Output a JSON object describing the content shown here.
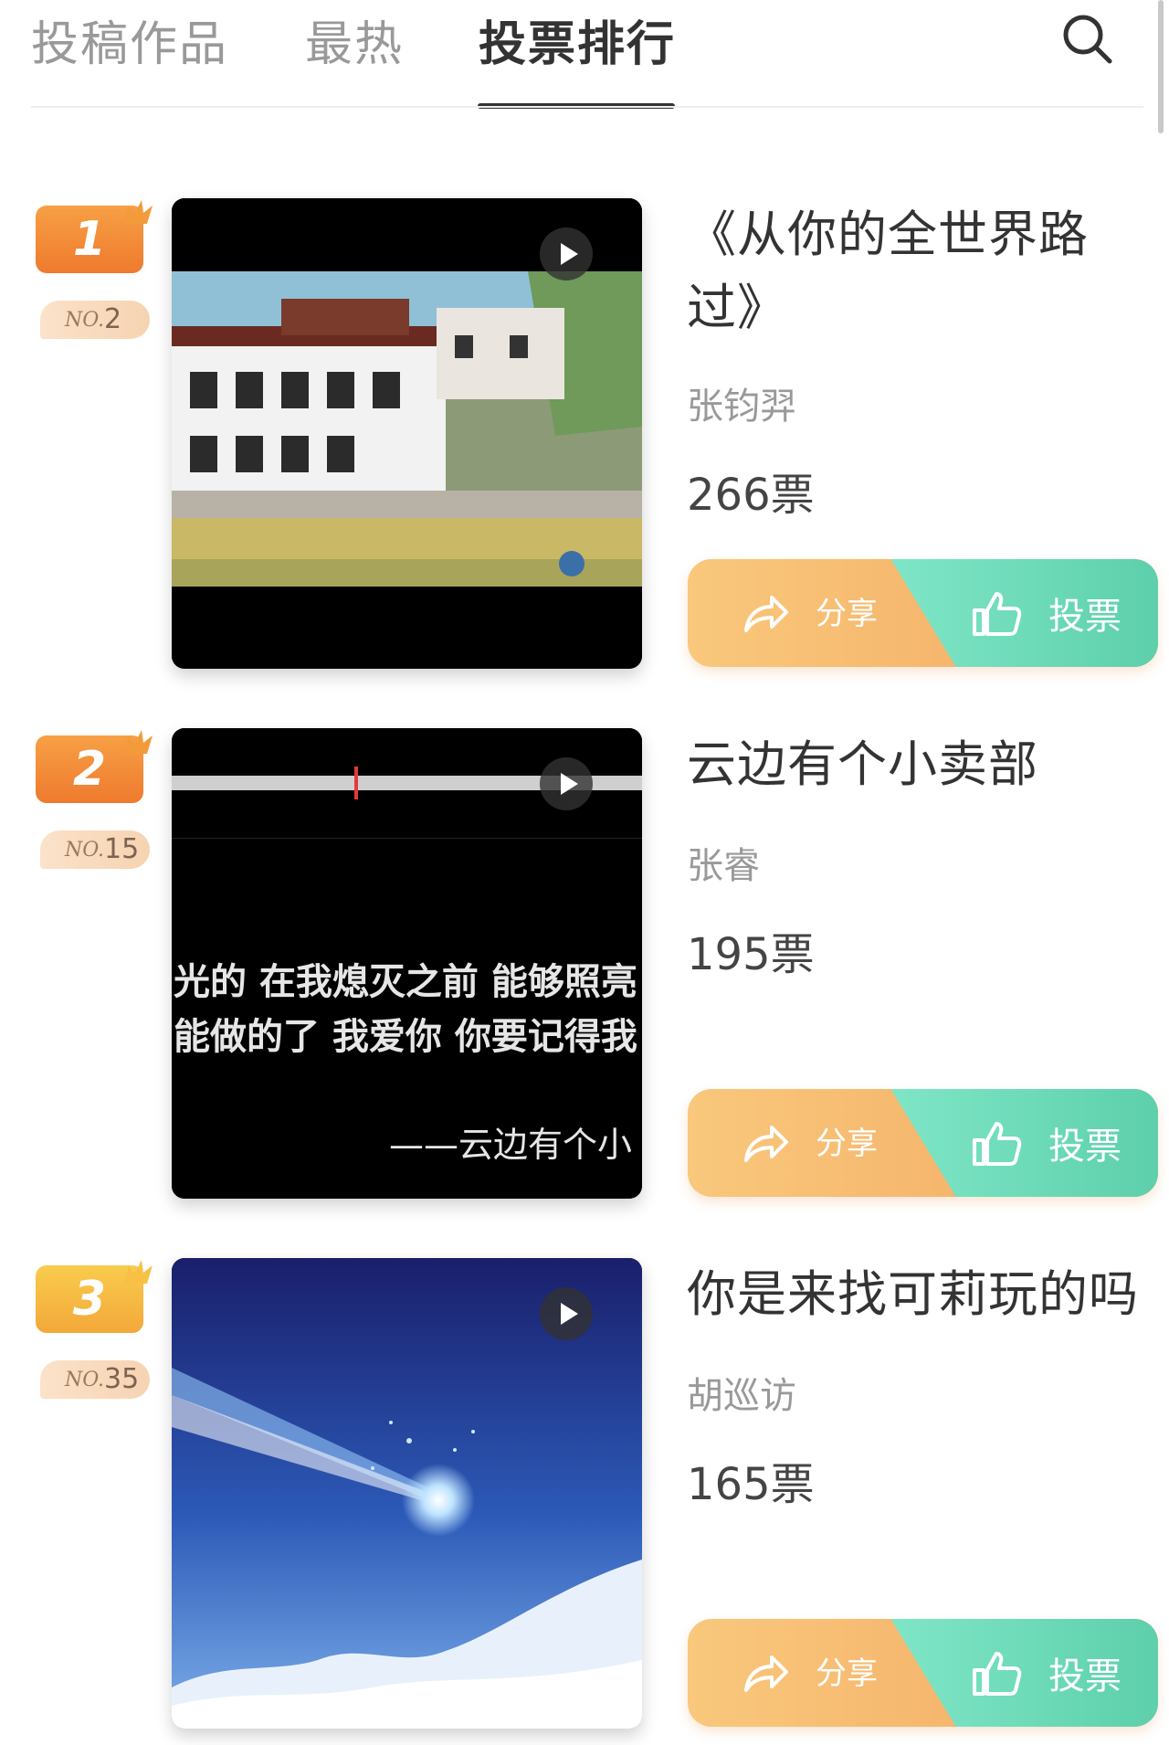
{
  "tabs": {
    "items": [
      {
        "label": "投稿作品",
        "active": false
      },
      {
        "label": "最热",
        "active": false
      },
      {
        "label": "投票排行",
        "active": true
      }
    ]
  },
  "entries": [
    {
      "rank": "1",
      "rank_color": "#f28b3a",
      "no_prefix": "NO.",
      "no_value": "2",
      "title": "《从你的全世界路过》",
      "author": "张钧羿",
      "votes": "266票",
      "share_label": "分享",
      "vote_label": "投票"
    },
    {
      "rank": "2",
      "rank_color": "#f28b3a",
      "no_prefix": "NO.",
      "no_value": "15",
      "title": "云边有个小卖部",
      "author": "张睿",
      "votes": "195票",
      "subtitle_line1": "光的 在我熄灭之前 能够照亮",
      "subtitle_line2": "能做的了 我爱你 你要记得我",
      "subtitle_line3": "——云边有个小",
      "share_label": "分享",
      "vote_label": "投票"
    },
    {
      "rank": "3",
      "rank_color": "#f5b73a",
      "no_prefix": "NO.",
      "no_value": "35",
      "title": "你是来找可莉玩的吗",
      "author": "胡巡访",
      "votes": "165票",
      "share_label": "分享",
      "vote_label": "投票"
    }
  ],
  "icons": {
    "search": "search-icon",
    "play": "play-icon",
    "share": "share-arrow-icon",
    "vote": "thumbs-up-icon"
  },
  "colors": {
    "share_gradient": [
      "#f9c87c",
      "#f2a862"
    ],
    "vote_gradient": [
      "#7fe6c7",
      "#5dcfaa"
    ]
  }
}
